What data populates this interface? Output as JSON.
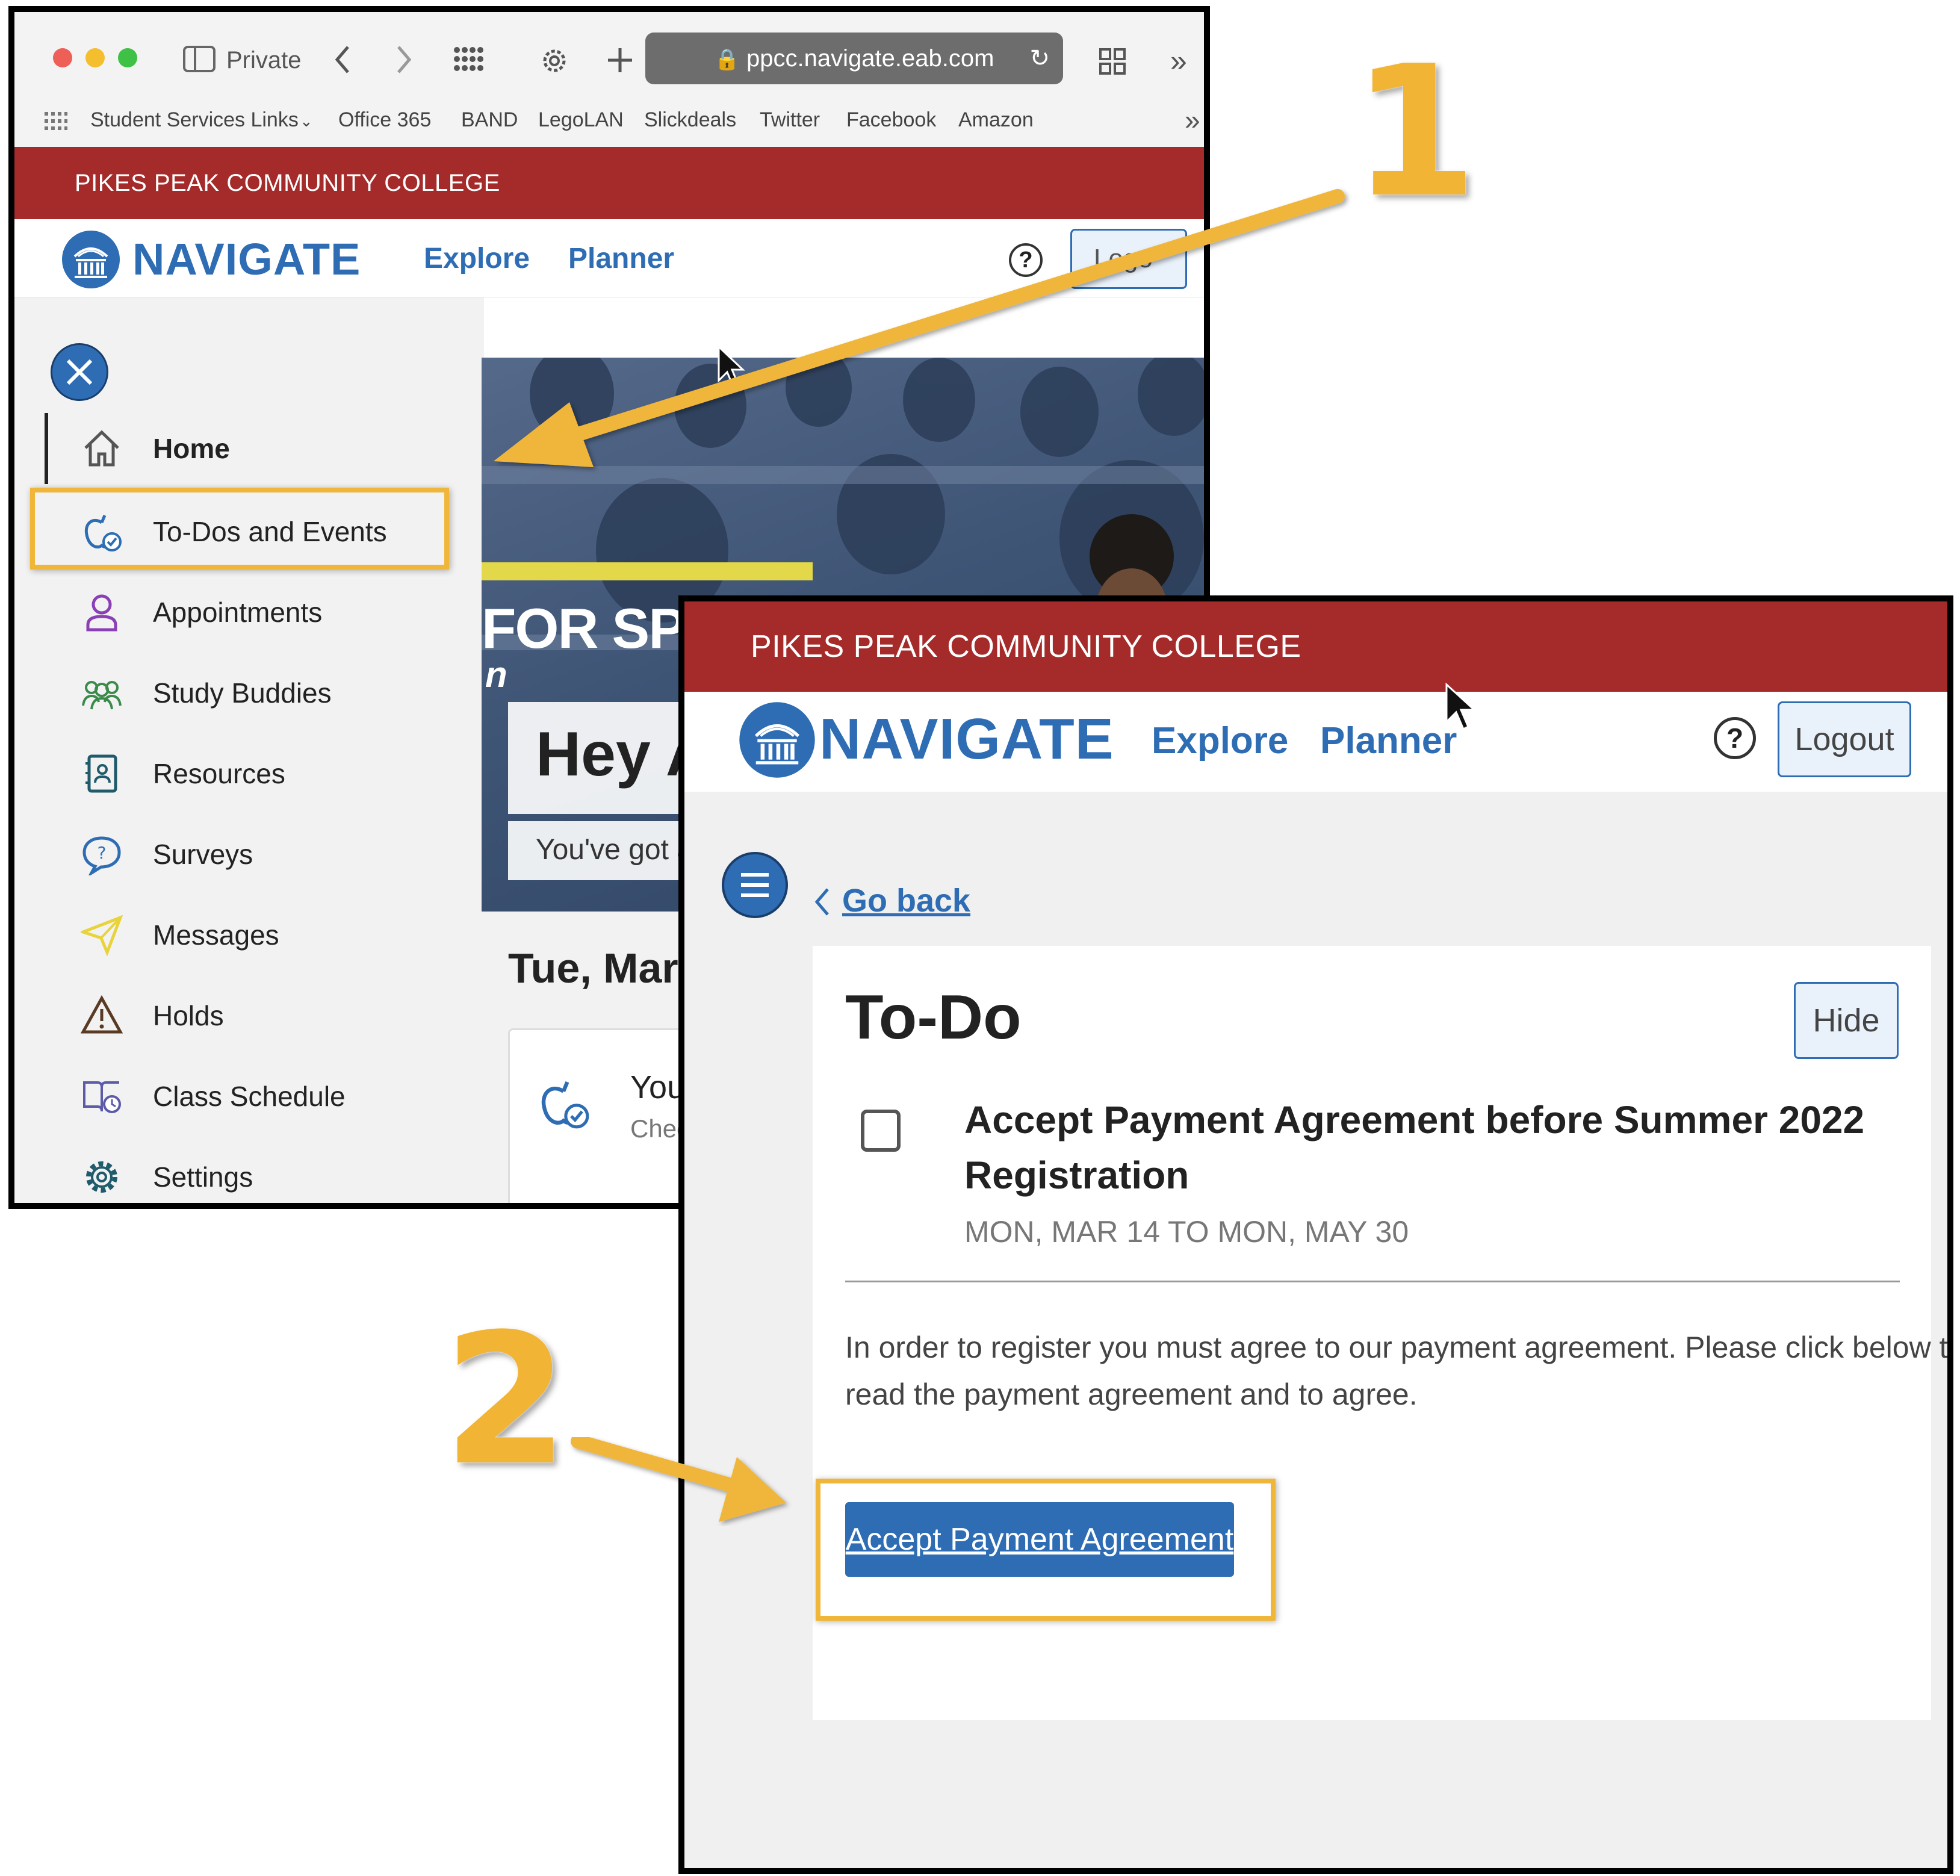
{
  "browser": {
    "private_label": "Private",
    "url": "ppcc.navigate.eab.com",
    "bookmarks": [
      "Student Services Links",
      "Office 365",
      "BAND",
      "LegoLAN",
      "Slickdeals",
      "Twitter",
      "Facebook",
      "Amazon"
    ]
  },
  "college_name": "PIKES PEAK COMMUNITY COLLEGE",
  "brand": "NAVIGATE",
  "nav": {
    "explore": "Explore",
    "planner": "Planner",
    "help": "?",
    "logout_partial": "Logo",
    "logout": "Logout"
  },
  "sidebar": {
    "items": [
      {
        "label": "Home",
        "icon": "home-icon"
      },
      {
        "label": "To-Dos and Events",
        "icon": "apple-check-icon"
      },
      {
        "label": "Appointments",
        "icon": "person-icon"
      },
      {
        "label": "Study Buddies",
        "icon": "people-icon"
      },
      {
        "label": "Resources",
        "icon": "contact-book-icon"
      },
      {
        "label": "Surveys",
        "icon": "question-bubble-icon"
      },
      {
        "label": "Messages",
        "icon": "paper-plane-icon"
      },
      {
        "label": "Holds",
        "icon": "warning-icon"
      },
      {
        "label": "Class Schedule",
        "icon": "book-clock-icon"
      },
      {
        "label": "Settings",
        "icon": "gear-icon"
      }
    ]
  },
  "home": {
    "hero_banner": "FOR SPRING",
    "hero_banner_2": "n",
    "greeting": "Hey A",
    "subtext": "You've got a",
    "date_heading": "Tue, Mar",
    "card_title": "You",
    "card_sub": "Chec"
  },
  "todo": {
    "go_back": "Go back",
    "title": "To-Do",
    "hide": "Hide",
    "item_title_line1": "Accept Payment Agreement before Summer 2022",
    "item_title_line2": "Registration",
    "item_dates": "MON, MAR 14 TO MON, MAY 30",
    "body_line1": "In order to register you must agree to our payment agreement. Please click below to",
    "body_line2": "read the payment agreement and to agree.",
    "button": "Accept Payment Agreement"
  },
  "annotations": {
    "step1": "1",
    "step2": "2"
  },
  "colors": {
    "banner": "#a52a2a",
    "navy_blue": "#2e6db4",
    "highlight": "#f0b63a"
  }
}
